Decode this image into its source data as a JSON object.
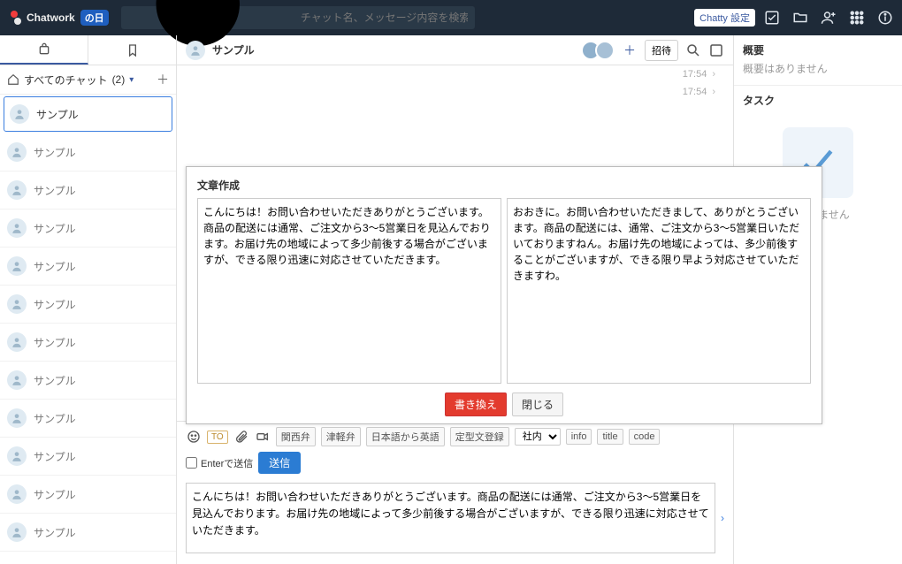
{
  "topbar": {
    "product": "Chatwork",
    "day_badge": "の日",
    "search_placeholder": "チャット名、メッセージ内容を検索",
    "chatty_label": "Chatty 設定"
  },
  "left": {
    "filter_label": "すべてのチャット",
    "filter_count": "(2)",
    "active_item": "サンプル",
    "items": [
      "サンプル",
      "サンプル",
      "サンプル",
      "サンプル",
      "サンプル",
      "サンプル",
      "サンプル",
      "サンプル",
      "サンプル",
      "サンプル",
      "サンプル"
    ]
  },
  "room": {
    "title": "サンプル",
    "invite_label": "招待",
    "timestamps": [
      "17:54",
      "17:54"
    ]
  },
  "right": {
    "overview_title": "概要",
    "overview_empty": "概要はありません",
    "task_title": "タスク",
    "task_empty_suffix": "はありません"
  },
  "editor": {
    "title": "文章作成",
    "left_text": "こんにちは！お問い合わせいただきありがとうございます。商品の配送には通常、ご注文から3～5営業日を見込んでおります。お届け先の地域によって多少前後する場合がございますが、できる限り迅速に対応させていただきます。",
    "right_text": "おおきに。お問い合わせいただきまして、ありがとうございます。商品の配送には、通常、ご注文から3～5営業日いただいておりますねん。お届け先の地域によっては、多少前後することがございますが、できる限り早よう対応させていただきますわ。",
    "rewrite_btn": "書き換え",
    "close_btn": "閉じる"
  },
  "compose": {
    "to_label": "TO",
    "convert_buttons": [
      "関西弁",
      "津軽弁",
      "日本語から英語"
    ],
    "register_label": "定型文登録",
    "select_options": [
      "社内"
    ],
    "chips": [
      "info",
      "title",
      "code"
    ],
    "enter_send_label": "Enterで送信",
    "send_label": "送信",
    "text": "こんにちは！お問い合わせいただきありがとうございます。商品の配送には通常、ご注文から3～5営業日を見込んでおります。お届け先の地域によって多少前後する場合がございますが、できる限り迅速に対応させていただきます。"
  }
}
